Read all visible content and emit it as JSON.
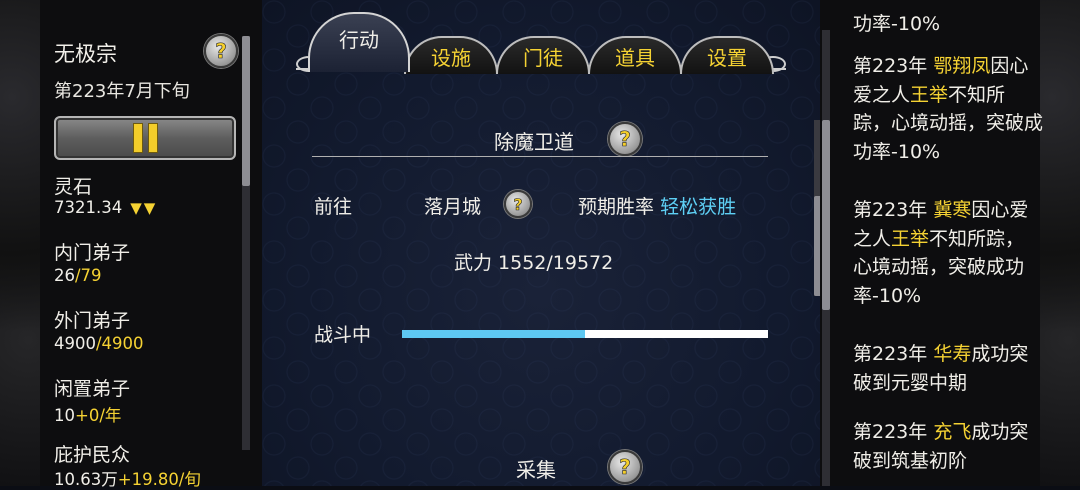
{
  "left": {
    "sect_name": "无极宗",
    "date": "第223年7月下旬",
    "help_glyph": "?",
    "resources": [
      {
        "label": "灵石",
        "value": "7321.34",
        "extra": "",
        "trend": "▼▼"
      },
      {
        "label": "内门弟子",
        "value": "26",
        "extra": "/79",
        "trend": ""
      },
      {
        "label": "外门弟子",
        "value": "4900",
        "extra": "/4900",
        "trend": ""
      },
      {
        "label": "闲置弟子",
        "value": "10",
        "extra": "+0/年",
        "trend": ""
      },
      {
        "label": "庇护民众",
        "value": "10.63万",
        "extra": "+19.80/旬",
        "trend": ""
      }
    ]
  },
  "tabs": {
    "active": "行动",
    "items": [
      "设施",
      "门徒",
      "道具",
      "设置"
    ]
  },
  "action": {
    "title": "除魔卫道",
    "go_label": "前往",
    "destination": "落月城",
    "win_rate_label": "预期胜率",
    "win_rate_value": "轻松获胜",
    "power_text": "武力 1552/19572",
    "battle_label": "战斗中",
    "progress": 0.5,
    "next_title": "采集"
  },
  "log": [
    {
      "pre": "",
      "name": "",
      "post": "功率-10%"
    },
    {
      "pre": "第223年 ",
      "name": "鄂翔凤",
      "post": "因心爱之人",
      "name2": "王举",
      "post2": "不知所踪，心境动摇，突破成功率-10%"
    },
    {
      "pre": "第223年 ",
      "name": "冀寒",
      "post": "因心爱之人",
      "name2": "王举",
      "post2": "不知所踪，心境动摇，突破成功率-10%"
    },
    {
      "pre": "第223年 ",
      "name": "华寿",
      "post": "成功突破到元婴中期"
    },
    {
      "pre": "第223年 ",
      "name": "充飞",
      "post": "成功突破到筑基初阶"
    }
  ],
  "colors": {
    "accent_yellow": "#f5d233",
    "accent_cyan": "#5ed0f5"
  }
}
